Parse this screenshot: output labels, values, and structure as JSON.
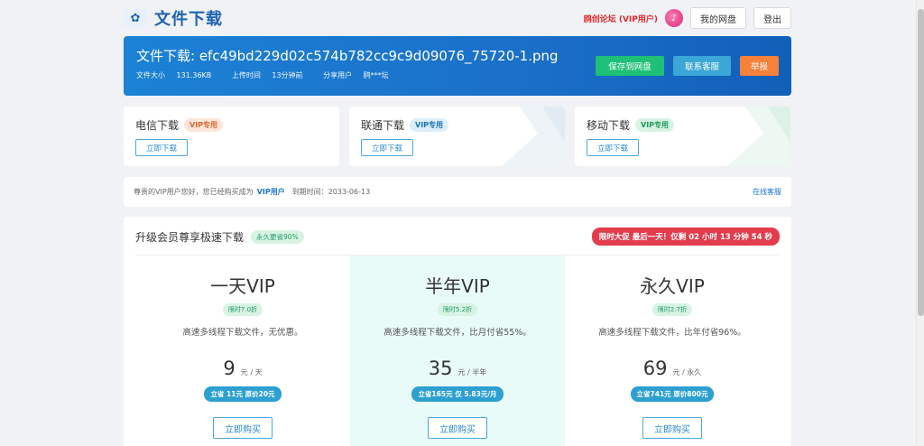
{
  "header": {
    "logo_glyph": "✿",
    "title": "文件下载",
    "forum_link": "鸥创论坛 (VIP用户)",
    "avatar_glyph": "♪",
    "my_drive": "我的网盘",
    "logout": "登出"
  },
  "file": {
    "title": "文件下载: efc49bd229d02c574b782cc9c9d09076_75720-1.png",
    "size_label": "文件大小",
    "size": "131.36KB",
    "upload_label": "上传时间",
    "upload_time": "13分钟前",
    "sharer_label": "分享用户",
    "sharer": "鸥***坛",
    "actions": {
      "save": "保存到网盘",
      "contact": "联系客服",
      "report": "举报"
    }
  },
  "downloads": [
    {
      "title": "电信下载",
      "badge": "VIP专用",
      "button": "立即下载"
    },
    {
      "title": "联通下载",
      "badge": "VIP专用",
      "button": "立即下载"
    },
    {
      "title": "移动下载",
      "badge": "VIP专用",
      "button": "立即下载"
    }
  ],
  "notice": {
    "prefix": "尊贵的VIP用户您好，您已经购买成为",
    "vip_word": "VIP用户",
    "expire_label": "到期时间：",
    "expire_date": "2033-06-13",
    "online_service": "在线客服"
  },
  "plans": {
    "title": "升级会员尊享极速下载",
    "discount_badge": "永久更省90%",
    "promo": "限时大促 最后一天！仅剩 02 小时 13 分钟 54 秒",
    "items": [
      {
        "name": "一天VIP",
        "tag": "限时7.0折",
        "desc": "高速多线程下载文件，无优惠。",
        "price": "9",
        "unit": "元 / 天",
        "save": "立省 11元 原价20元",
        "buy": "立即购买"
      },
      {
        "name": "半年VIP",
        "tag": "限时5.2折",
        "desc": "高速多线程下载文件，比月付省55%。",
        "price": "35",
        "unit": "元 / 半年",
        "save": "立省165元 仅 5.83元/月",
        "buy": "立即购买"
      },
      {
        "name": "永久VIP",
        "tag": "限时2.7折",
        "desc": "高速多线程下载文件，比年付省96%。",
        "price": "69",
        "unit": "元 / 永久",
        "save": "立省741元 原价800元",
        "buy": "立即购买"
      }
    ]
  },
  "colors": {
    "brand_blue": "#1e63b3",
    "banner_blue": "#1b6fc9",
    "green": "#1ec075",
    "teal": "#3aa7d6",
    "orange": "#f5813a",
    "promo_red": "#e33d4d"
  }
}
